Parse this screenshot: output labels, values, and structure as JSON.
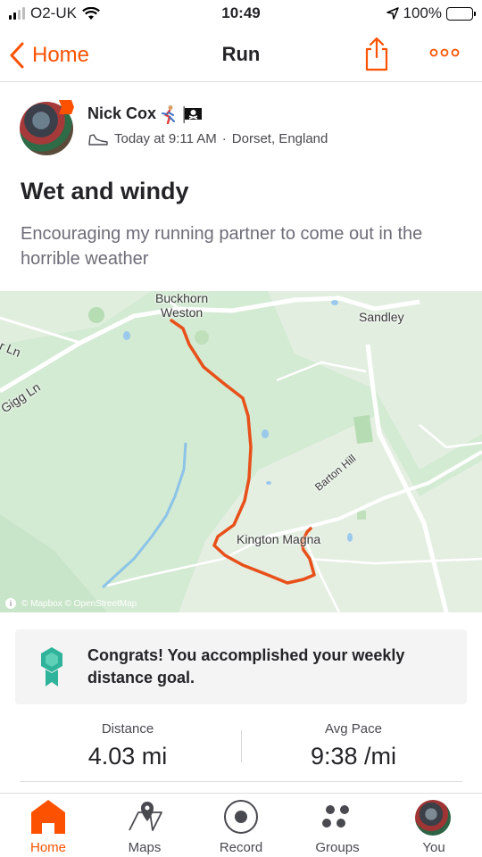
{
  "status_bar": {
    "carrier": "O2-UK",
    "time": "10:49",
    "battery": "100%"
  },
  "nav": {
    "back_label": "Home",
    "title": "Run"
  },
  "activity": {
    "athlete_name": "Nick Cox",
    "timestamp": "Today at 9:11 AM",
    "separator": "·",
    "location": "Dorset, England",
    "title": "Wet and windy",
    "description": "Encouraging my running partner to come out in the horrible weather"
  },
  "map": {
    "labels": {
      "buckhorn_1": "Buckhorn",
      "buckhorn_2": "Weston",
      "sandley": "Sandley",
      "or_ln": "or Ln",
      "gigg_ln": "Gigg Ln",
      "barton_hill": "Barton Hill",
      "kington_magna": "Kington Magna"
    },
    "attribution": "© Mapbox © OpenStreetMap",
    "route_color": "#e8501a"
  },
  "goal": {
    "message": "Congrats! You accomplished your weekly distance goal."
  },
  "stats": [
    {
      "label": "Distance",
      "value": "4.03 mi"
    },
    {
      "label": "Avg Pace",
      "value": "9:38 /mi"
    }
  ],
  "tabs": [
    {
      "label": "Home",
      "icon": "home-icon",
      "active": true
    },
    {
      "label": "Maps",
      "icon": "map-pin-icon",
      "active": false
    },
    {
      "label": "Record",
      "icon": "record-icon",
      "active": false
    },
    {
      "label": "Groups",
      "icon": "groups-icon",
      "active": false
    },
    {
      "label": "You",
      "icon": "profile-avatar",
      "active": false
    }
  ],
  "colors": {
    "accent": "#fc5200",
    "goal_badge": "#2fb39a"
  }
}
